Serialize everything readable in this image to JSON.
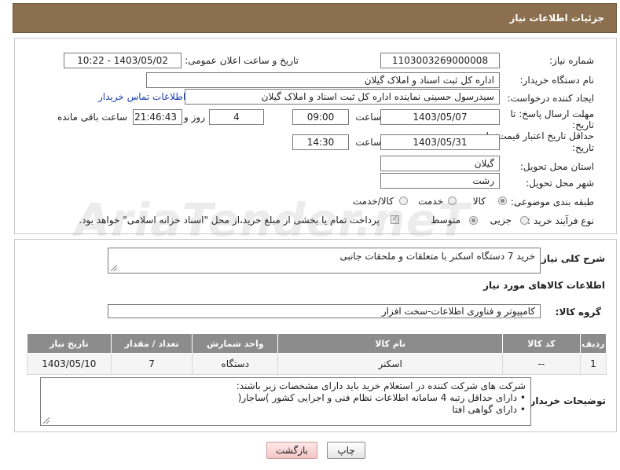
{
  "header": {
    "title": "جزئیات اطلاعات نیاز"
  },
  "need": {
    "number_label": "شماره نیاز:",
    "number_value": "1103003269000008",
    "announce_label": "تاریخ و ساعت اعلان عمومی:",
    "announce_value": "1403/05/02 - 10:22",
    "buyer_label": "نام دستگاه خریدار:",
    "buyer_value": "اداره کل ثبت اسناد و املاک گیلان",
    "creator_label": "ایجاد کننده درخواست:",
    "creator_value": "سیدرسول حسینی نماینده اداره کل ثبت اسناد و املاک گیلان",
    "contact_link": "اطلاعات تماس خریدار",
    "deadline_label_1": "مهلت ارسال پاسخ: تا",
    "deadline_label_2": "تاریخ:",
    "deadline_date": "1403/05/07",
    "time_label": "ساعت",
    "deadline_time": "09:00",
    "days_value": "4",
    "days_label": "روز و",
    "remaining_time": "21:46:43",
    "remaining_label": "ساعت باقی مانده",
    "validity_label_1": "حداقل تاریخ اعتبار قیمت: تا",
    "validity_label_2": "تاریخ:",
    "validity_date": "1403/05/31",
    "validity_time_label": "ساعت",
    "validity_time": "14:30",
    "province_label": "استان محل تحویل:",
    "province_value": "گیلان",
    "city_label": "شهر محل تحویل:",
    "city_value": "رشت",
    "category_label": "طبقه بندی موضوعی:",
    "category_options": [
      "کالا",
      "خدمت",
      "کالا/خدمت"
    ],
    "category_selected": "کالا",
    "process_label": "نوع فرآیند خرید :",
    "process_options": [
      "جزیی",
      "متوسط"
    ],
    "payment_note": "پرداخت تمام یا بخشی از مبلغ خرید،از محل \"اسناد خزانه اسلامی\" خواهد بود."
  },
  "summary": {
    "label": "شرح کلی نیاز:",
    "value": "خرید 7 دستگاه اسکنر با متعلقات و ملحقات جانبی"
  },
  "goods_section": {
    "title": "اطلاعات کالاهای مورد نیاز",
    "group_label": "گروه کالا:",
    "group_value": "کامپیوتر و فناوری اطلاعات-سخت افزار"
  },
  "table": {
    "headers": [
      "ردیف",
      "کد کالا",
      "نام کالا",
      "واحد شمارش",
      "تعداد / مقدار",
      "تاریخ نیاز"
    ],
    "rows": [
      [
        "1",
        "--",
        "اسکنر",
        "دستگاه",
        "7",
        "1403/05/10"
      ]
    ]
  },
  "buyer_notes": {
    "label": "توضیحات خریدار:",
    "lines": [
      "شرکت های شرکت کننده در استعلام خرید باید  دارای مشخصات زیر باشند:",
      "• دارای حداقل رتبه 4 سامانه اطلاعات نظام فنی و اجرایی کشور )ساجار(",
      "• دارای گواهی افتا"
    ]
  },
  "buttons": {
    "print": "چاپ",
    "back": "بازگشت"
  },
  "watermark": "AriaTender.neT"
}
